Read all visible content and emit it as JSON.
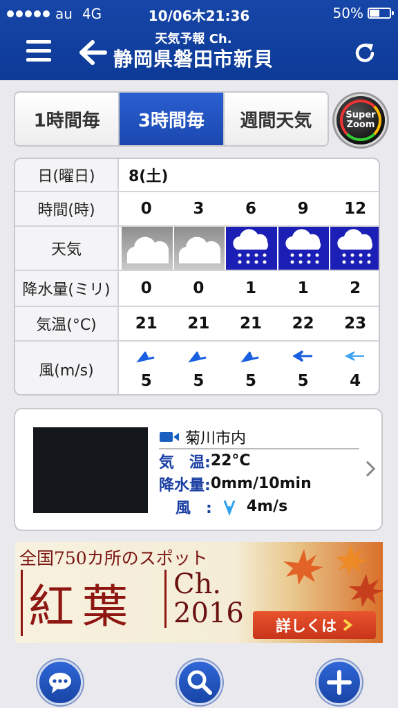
{
  "status_bar": {
    "carrier": "au",
    "network": "4G",
    "datetime": "10/06木21:36",
    "battery": "50%",
    "battery_level": 0.5
  },
  "header": {
    "subtitle": "天気予報 Ch.",
    "title": "静岡県磐田市新貝",
    "icons": [
      "menu-icon",
      "back-arrow-icon",
      "refresh-icon"
    ]
  },
  "tabs": [
    {
      "label": "1時間毎",
      "active": false
    },
    {
      "label": "3時間毎",
      "active": true
    },
    {
      "label": "週間天気",
      "active": false
    }
  ],
  "super_zoom": {
    "line1": "Super",
    "line2": "Zoom"
  },
  "forecast": {
    "rows": {
      "day": {
        "label": "日(曜日)",
        "value": "8(土)"
      },
      "hour": {
        "label": "時間(時)",
        "values": [
          "0",
          "3",
          "6",
          "9",
          "12"
        ]
      },
      "weather": {
        "label": "天気",
        "values": [
          "cloudy",
          "cloudy",
          "rain",
          "rain",
          "rain"
        ]
      },
      "precip": {
        "label": "降水量(ミリ)",
        "values": [
          "0",
          "0",
          "1",
          "1",
          "2"
        ]
      },
      "temp": {
        "label": "気温(°C)",
        "values": [
          "21",
          "21",
          "21",
          "22",
          "23"
        ]
      },
      "wind": {
        "label": "風(m/s)",
        "values": [
          "5",
          "5",
          "5",
          "5",
          "4"
        ]
      }
    },
    "colors": {
      "rain_bg": "#1b1fb5",
      "wind_arrow": "#1a5fe0"
    }
  },
  "live_camera": {
    "location": "菊川市内",
    "temp_key": "気　温:",
    "temp_value": "22°C",
    "precip_key": "降水量:",
    "precip_value": "0mm/10min",
    "wind_key": "風　:",
    "wind_value": "4m/s"
  },
  "banner": {
    "top_text": "全国750カ所のスポット",
    "big_text": "紅葉",
    "ch_text": "Ch.",
    "year": "2016",
    "button_label": "詳しくは"
  },
  "bottom_bar": {
    "icons": [
      "chat-icon",
      "search-icon",
      "plus-icon"
    ],
    "accent": "#1d4bb0"
  }
}
